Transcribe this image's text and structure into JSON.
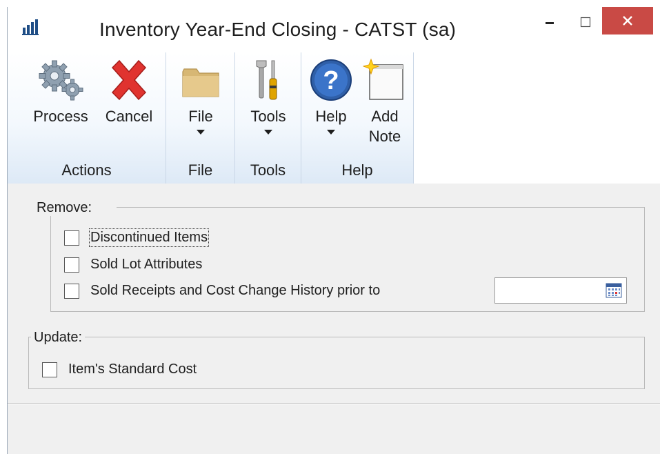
{
  "window": {
    "title": "Inventory Year-End Closing  -  CATST (sa)"
  },
  "ribbon": {
    "groups": [
      {
        "label": "Actions",
        "buttons": [
          {
            "label": "Process"
          },
          {
            "label": "Cancel"
          }
        ]
      },
      {
        "label": "File",
        "buttons": [
          {
            "label": "File"
          }
        ]
      },
      {
        "label": "Tools",
        "buttons": [
          {
            "label": "Tools"
          }
        ]
      },
      {
        "label": "Help",
        "buttons": [
          {
            "label": "Help"
          },
          {
            "label_line1": "Add",
            "label_line2": "Note"
          }
        ]
      }
    ]
  },
  "remove": {
    "legend": "Remove:",
    "options": [
      {
        "label": "Discontinued Items",
        "checked": false
      },
      {
        "label": "Sold Lot Attributes",
        "checked": false
      },
      {
        "label": "Sold Receipts and Cost Change History prior to",
        "checked": false
      }
    ],
    "date_value": ""
  },
  "update": {
    "legend": "Update:",
    "options": [
      {
        "label": "Item's Standard Cost",
        "checked": false
      }
    ]
  },
  "colors": {
    "close_button": "#c94a45",
    "ribbon_border": "#a9bdd6"
  }
}
